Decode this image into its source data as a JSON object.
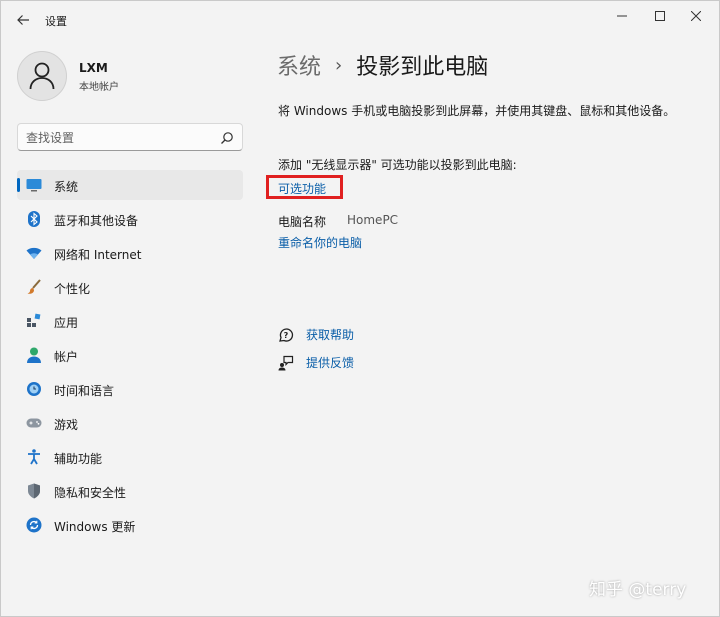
{
  "app_title": "设置",
  "profile": {
    "name": "LXM",
    "account_type": "本地帐户"
  },
  "search": {
    "placeholder": "查找设置"
  },
  "nav": {
    "items": [
      {
        "label": "系统",
        "icon": "system-icon",
        "active": true
      },
      {
        "label": "蓝牙和其他设备",
        "icon": "bluetooth-icon"
      },
      {
        "label": "网络和 Internet",
        "icon": "network-icon"
      },
      {
        "label": "个性化",
        "icon": "brush-icon"
      },
      {
        "label": "应用",
        "icon": "apps-icon"
      },
      {
        "label": "帐户",
        "icon": "account-icon"
      },
      {
        "label": "时间和语言",
        "icon": "time-language-icon"
      },
      {
        "label": "游戏",
        "icon": "gaming-icon"
      },
      {
        "label": "辅助功能",
        "icon": "accessibility-icon"
      },
      {
        "label": "隐私和安全性",
        "icon": "shield-icon"
      },
      {
        "label": "Windows 更新",
        "icon": "update-icon"
      }
    ]
  },
  "breadcrumb": {
    "parent": "系统",
    "separator": "›",
    "current": "投影到此电脑"
  },
  "main": {
    "description": "将 Windows 手机或电脑投影到此屏幕，并使用其键盘、鼠标和其他设备。",
    "optional_hint": "添加 \"无线显示器\" 可选功能以投影到此电脑:",
    "optional_link": "可选功能",
    "pc_name_label": "电脑名称",
    "pc_name_value": "HomePC",
    "rename_link": "重命名你的电脑",
    "get_help": "获取帮助",
    "feedback": "提供反馈"
  },
  "watermark": "知乎 @terry",
  "colors": {
    "accent": "#0067c0",
    "link": "#0a5ea8",
    "highlight_box": "#e02020"
  }
}
